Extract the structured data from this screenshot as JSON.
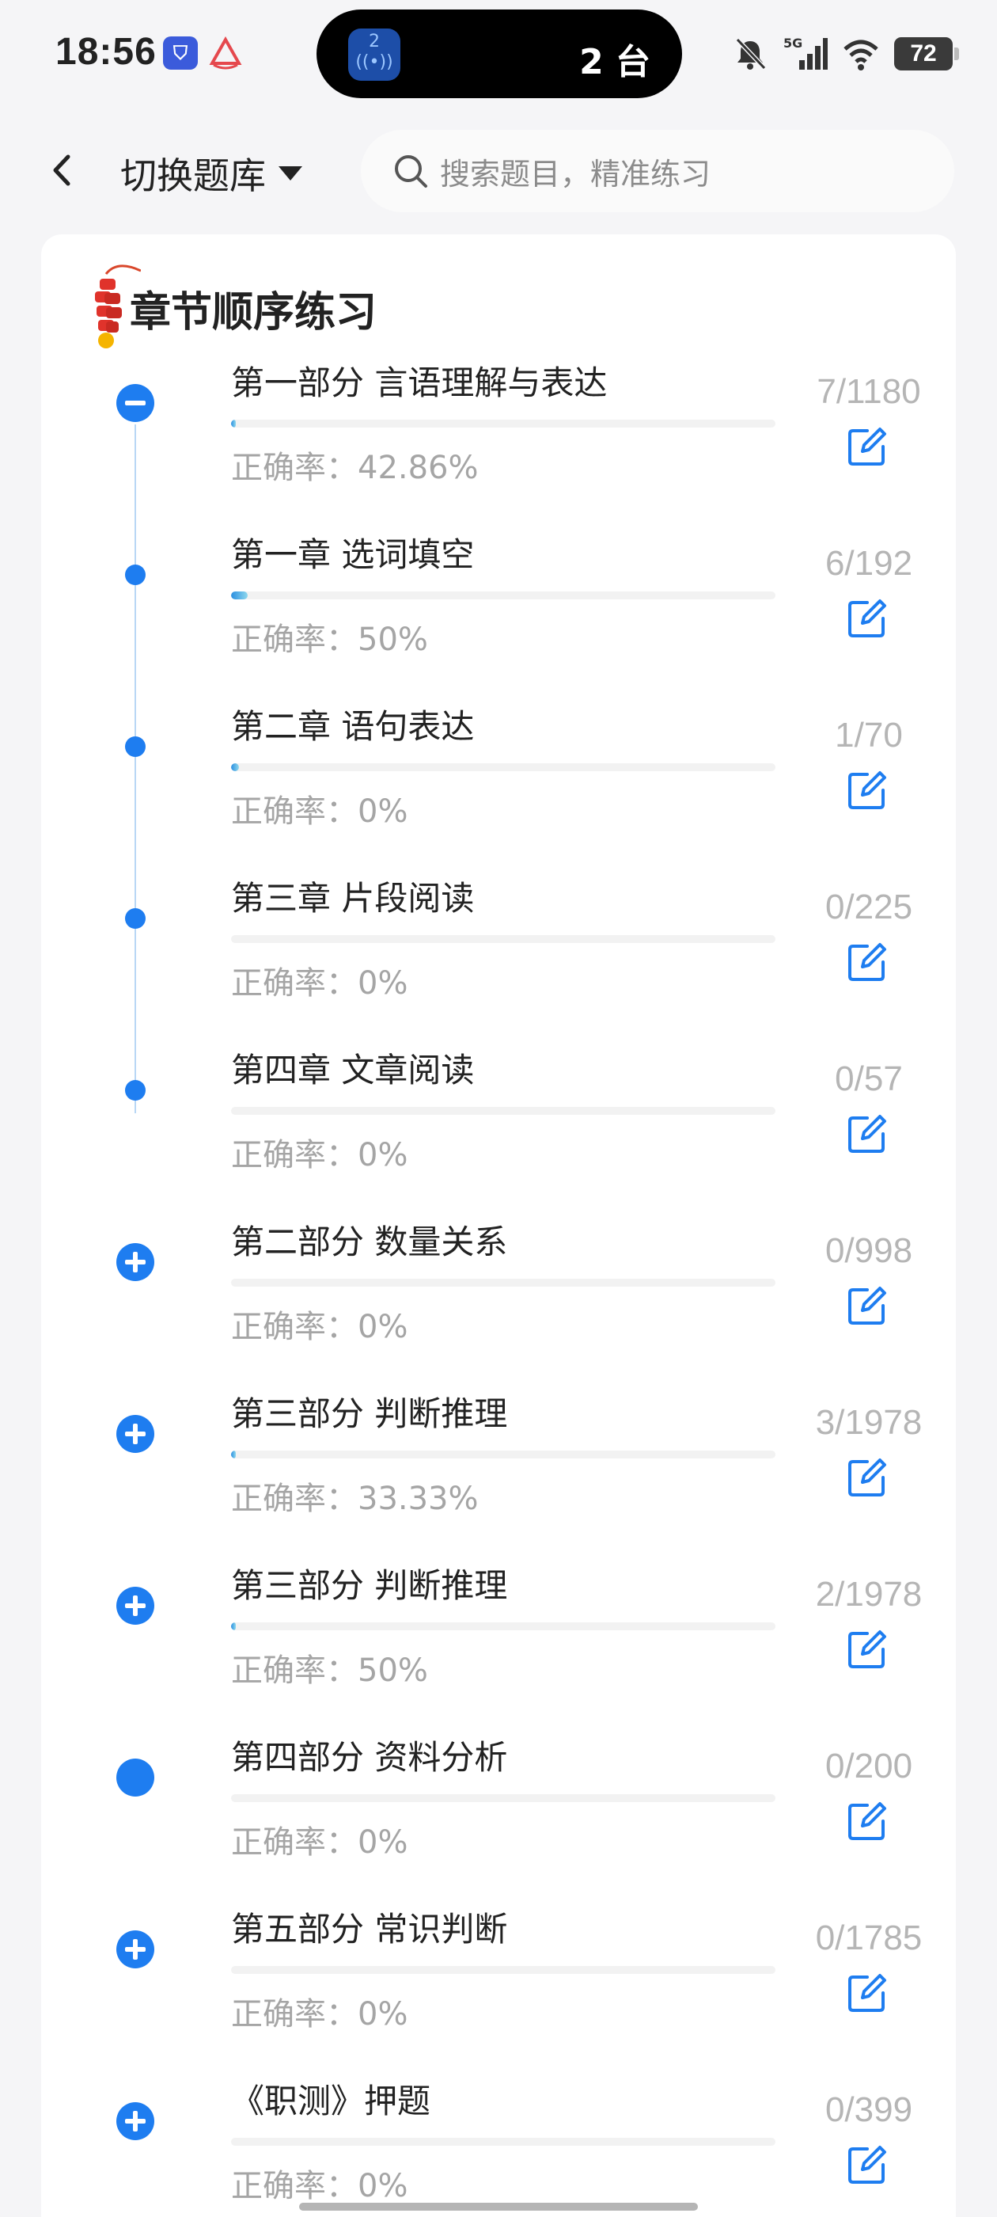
{
  "status_bar": {
    "time": "18:56",
    "app1_icon": "shield-app-icon",
    "app2_icon": "boat-app-icon",
    "island": {
      "badge": "2",
      "text": "2 台"
    },
    "signal_label": "5G",
    "battery": "72"
  },
  "header": {
    "switch_label": "切换题库",
    "search_placeholder": "搜索题目，精准练习"
  },
  "section": {
    "title": "章节顺序练习"
  },
  "accuracy_prefix": "正确率：",
  "items": [
    {
      "title": "第一部分 言语理解与表达",
      "accuracy": "正确率：42.86%",
      "count": "7/1180",
      "node": "minus",
      "progress": 0.006
    },
    {
      "title": "第一章 选词填空",
      "accuracy": "正确率：50%",
      "count": "6/192",
      "node": "dot",
      "progress": 0.03
    },
    {
      "title": "第二章 语句表达",
      "accuracy": "正确率：0%",
      "count": "1/70",
      "node": "dot",
      "progress": 0.014
    },
    {
      "title": "第三章 片段阅读",
      "accuracy": "正确率：0%",
      "count": "0/225",
      "node": "dot",
      "progress": 0
    },
    {
      "title": "第四章 文章阅读",
      "accuracy": "正确率：0%",
      "count": "0/57",
      "node": "dot",
      "progress": 0
    },
    {
      "title": "第二部分 数量关系",
      "accuracy": "正确率：0%",
      "count": "0/998",
      "node": "plus",
      "progress": 0
    },
    {
      "title": "第三部分 判断推理",
      "accuracy": "正确率：33.33%",
      "count": "3/1978",
      "node": "plus",
      "progress": 0.0015
    },
    {
      "title": "第三部分 判断推理",
      "accuracy": "正确率：50%",
      "count": "2/1978",
      "node": "plus",
      "progress": 0.001
    },
    {
      "title": "第四部分 资料分析",
      "accuracy": "正确率：0%",
      "count": "0/200",
      "node": "filled",
      "progress": 0
    },
    {
      "title": "第五部分 常识判断",
      "accuracy": "正确率：0%",
      "count": "0/1785",
      "node": "plus",
      "progress": 0
    },
    {
      "title": "《职测》押题",
      "accuracy": "正确率：0%",
      "count": "0/399",
      "node": "plus",
      "progress": 0
    }
  ],
  "colors": {
    "accent": "#1e7df0",
    "timeline": "#b9d7f5",
    "muted": "#a5a5a5"
  }
}
